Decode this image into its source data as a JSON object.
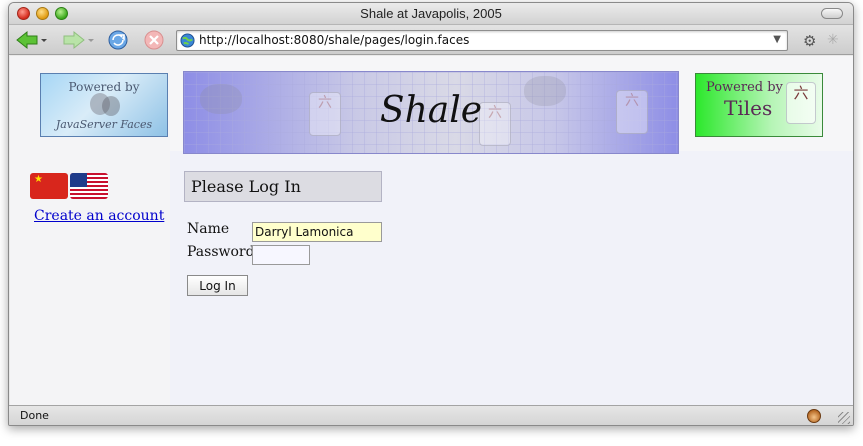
{
  "window": {
    "title": "Shale at Javapolis, 2005"
  },
  "toolbar": {
    "url": "http://localhost:8080/shale/pages/login.faces"
  },
  "logos": {
    "jsf_line1": "Powered by",
    "jsf_line2": "JavaServer Faces",
    "banner_title": "Shale",
    "tiles_line1": "Powered by",
    "tiles_line2": "Tiles",
    "tile_glyph": "六"
  },
  "sidebar": {
    "create_account_label": "Create an account"
  },
  "login": {
    "header": "Please Log In",
    "name_label": "Name",
    "name_value": "Darryl Lamonica",
    "password_label": "Password",
    "submit_label": "Log In"
  },
  "status": {
    "text": "Done"
  },
  "colors": {
    "link": "#0000cc",
    "name_input_bg": "#ffffcc",
    "banner_accent": "#8e8ee6",
    "tiles_accent": "#2ce82c"
  }
}
